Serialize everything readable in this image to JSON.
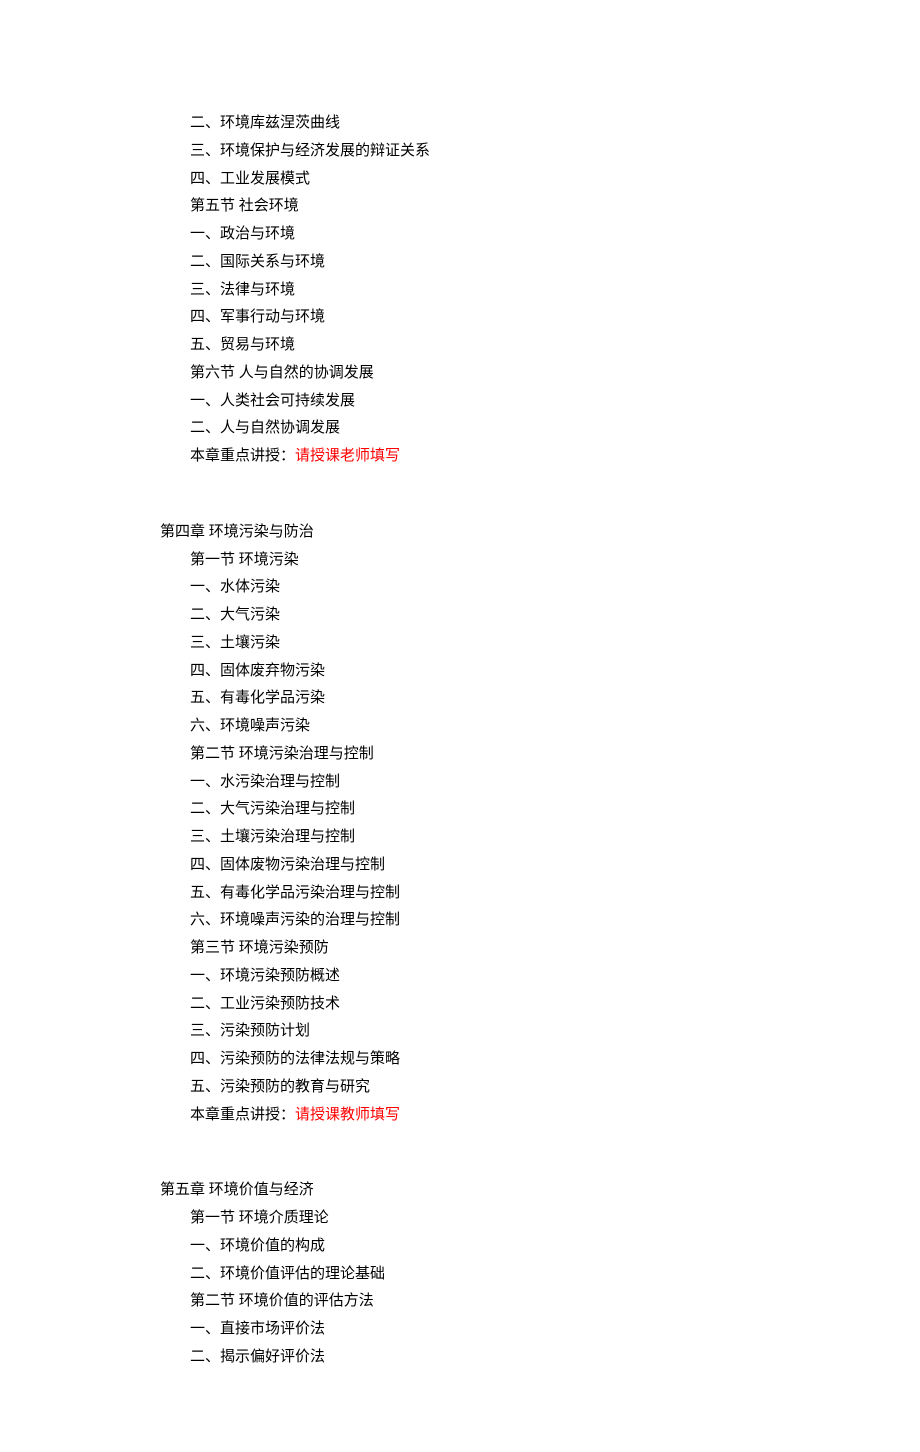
{
  "block1": {
    "items": [
      "二、环境库兹涅茨曲线",
      "三、环境保护与经济发展的辩证关系",
      "四、工业发展模式",
      "第五节   社会环境",
      "一、政治与环境",
      "二、国际关系与环境",
      "三、法律与环境",
      "四、军事行动与环境",
      "五、贸易与环境",
      "第六节   人与自然的协调发展",
      "一、人类社会可持续发展",
      "二、人与自然协调发展"
    ],
    "focus_prefix": "本章重点讲授：",
    "focus_highlight": "请授课老师填写"
  },
  "chapter4": {
    "title": "第四章   环境污染与防治",
    "items": [
      "第一节   环境污染",
      "一、水体污染",
      "二、大气污染",
      "三、土壤污染",
      "四、固体废弃物污染",
      "五、有毒化学品污染",
      "六、环境噪声污染",
      "第二节   环境污染治理与控制",
      "一、水污染治理与控制",
      "二、大气污染治理与控制",
      "三、土壤污染治理与控制",
      "四、固体废物污染治理与控制",
      "五、有毒化学品污染治理与控制",
      "六、环境噪声污染的治理与控制",
      "第三节   环境污染预防",
      "一、环境污染预防概述",
      "二、工业污染预防技术",
      "三、污染预防计划",
      "四、污染预防的法律法规与策略",
      "五、污染预防的教育与研究"
    ],
    "focus_prefix": "本章重点讲授：",
    "focus_highlight": "请授课教师填写"
  },
  "chapter5": {
    "title": "第五章   环境价值与经济",
    "items": [
      "第一节   环境介质理论",
      "一、环境价值的构成",
      "二、环境价值评估的理论基础",
      "第二节   环境价值的评估方法",
      "一、直接市场评价法",
      "二、揭示偏好评价法"
    ]
  }
}
